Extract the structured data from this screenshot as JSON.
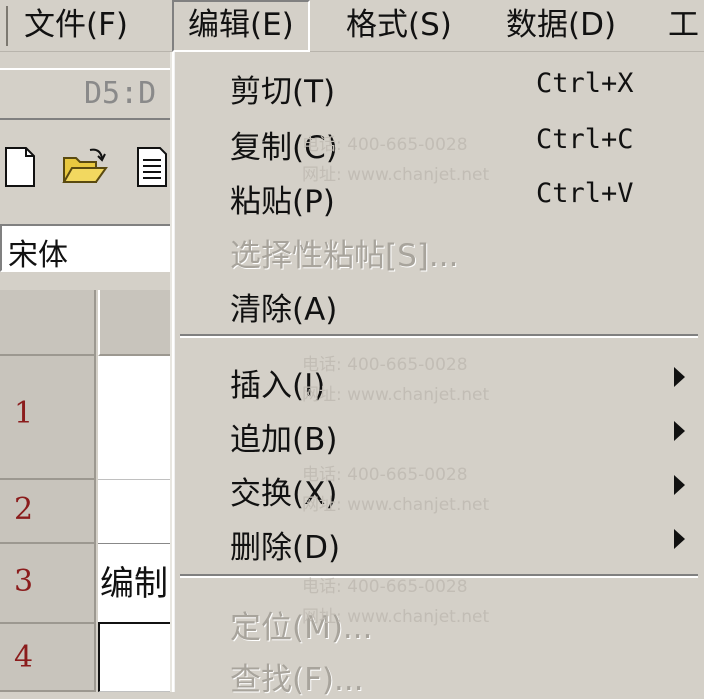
{
  "menubar": {
    "items": [
      {
        "label": "文件(F)"
      },
      {
        "label": "编辑(E)"
      },
      {
        "label": "格式(S)"
      },
      {
        "label": "数据(D)"
      },
      {
        "label": "工"
      }
    ]
  },
  "name_box": {
    "value": "D5:D"
  },
  "font_box": {
    "value": "宋体"
  },
  "sheet": {
    "row_headers": [
      "1",
      "2",
      "3",
      "4"
    ],
    "cell_b3": "编制"
  },
  "edit_menu": {
    "items": [
      {
        "label": "剪切(T)",
        "shortcut": "Ctrl+X"
      },
      {
        "label": "复制(C)",
        "shortcut": "Ctrl+C"
      },
      {
        "label": "粘贴(P)",
        "shortcut": "Ctrl+V"
      },
      {
        "label": "选择性粘帖[S]..."
      },
      {
        "label": "清除(A)"
      },
      {
        "label": "插入(I)"
      },
      {
        "label": "追加(B)"
      },
      {
        "label": "交换(X)"
      },
      {
        "label": "删除(D)"
      },
      {
        "label": "定位(M)..."
      },
      {
        "label": "查找(F)..."
      }
    ]
  },
  "watermark": {
    "phone": "电话: 400-665-0028",
    "site": "网址: www.chanjet.net"
  }
}
